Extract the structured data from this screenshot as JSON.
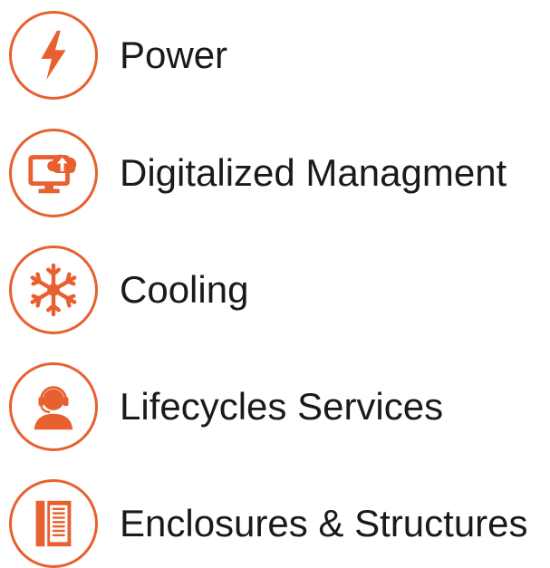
{
  "accent_color": "#e8602f",
  "items": [
    {
      "label": "Power",
      "icon": "lightning-bolt-icon"
    },
    {
      "label": "Digitalized Managment",
      "icon": "monitor-cloud-upload-icon"
    },
    {
      "label": "Cooling",
      "icon": "snowflake-icon"
    },
    {
      "label": "Lifecycles Services",
      "icon": "support-headset-icon"
    },
    {
      "label": "Enclosures & Structures",
      "icon": "rack-cabinet-icon"
    }
  ]
}
